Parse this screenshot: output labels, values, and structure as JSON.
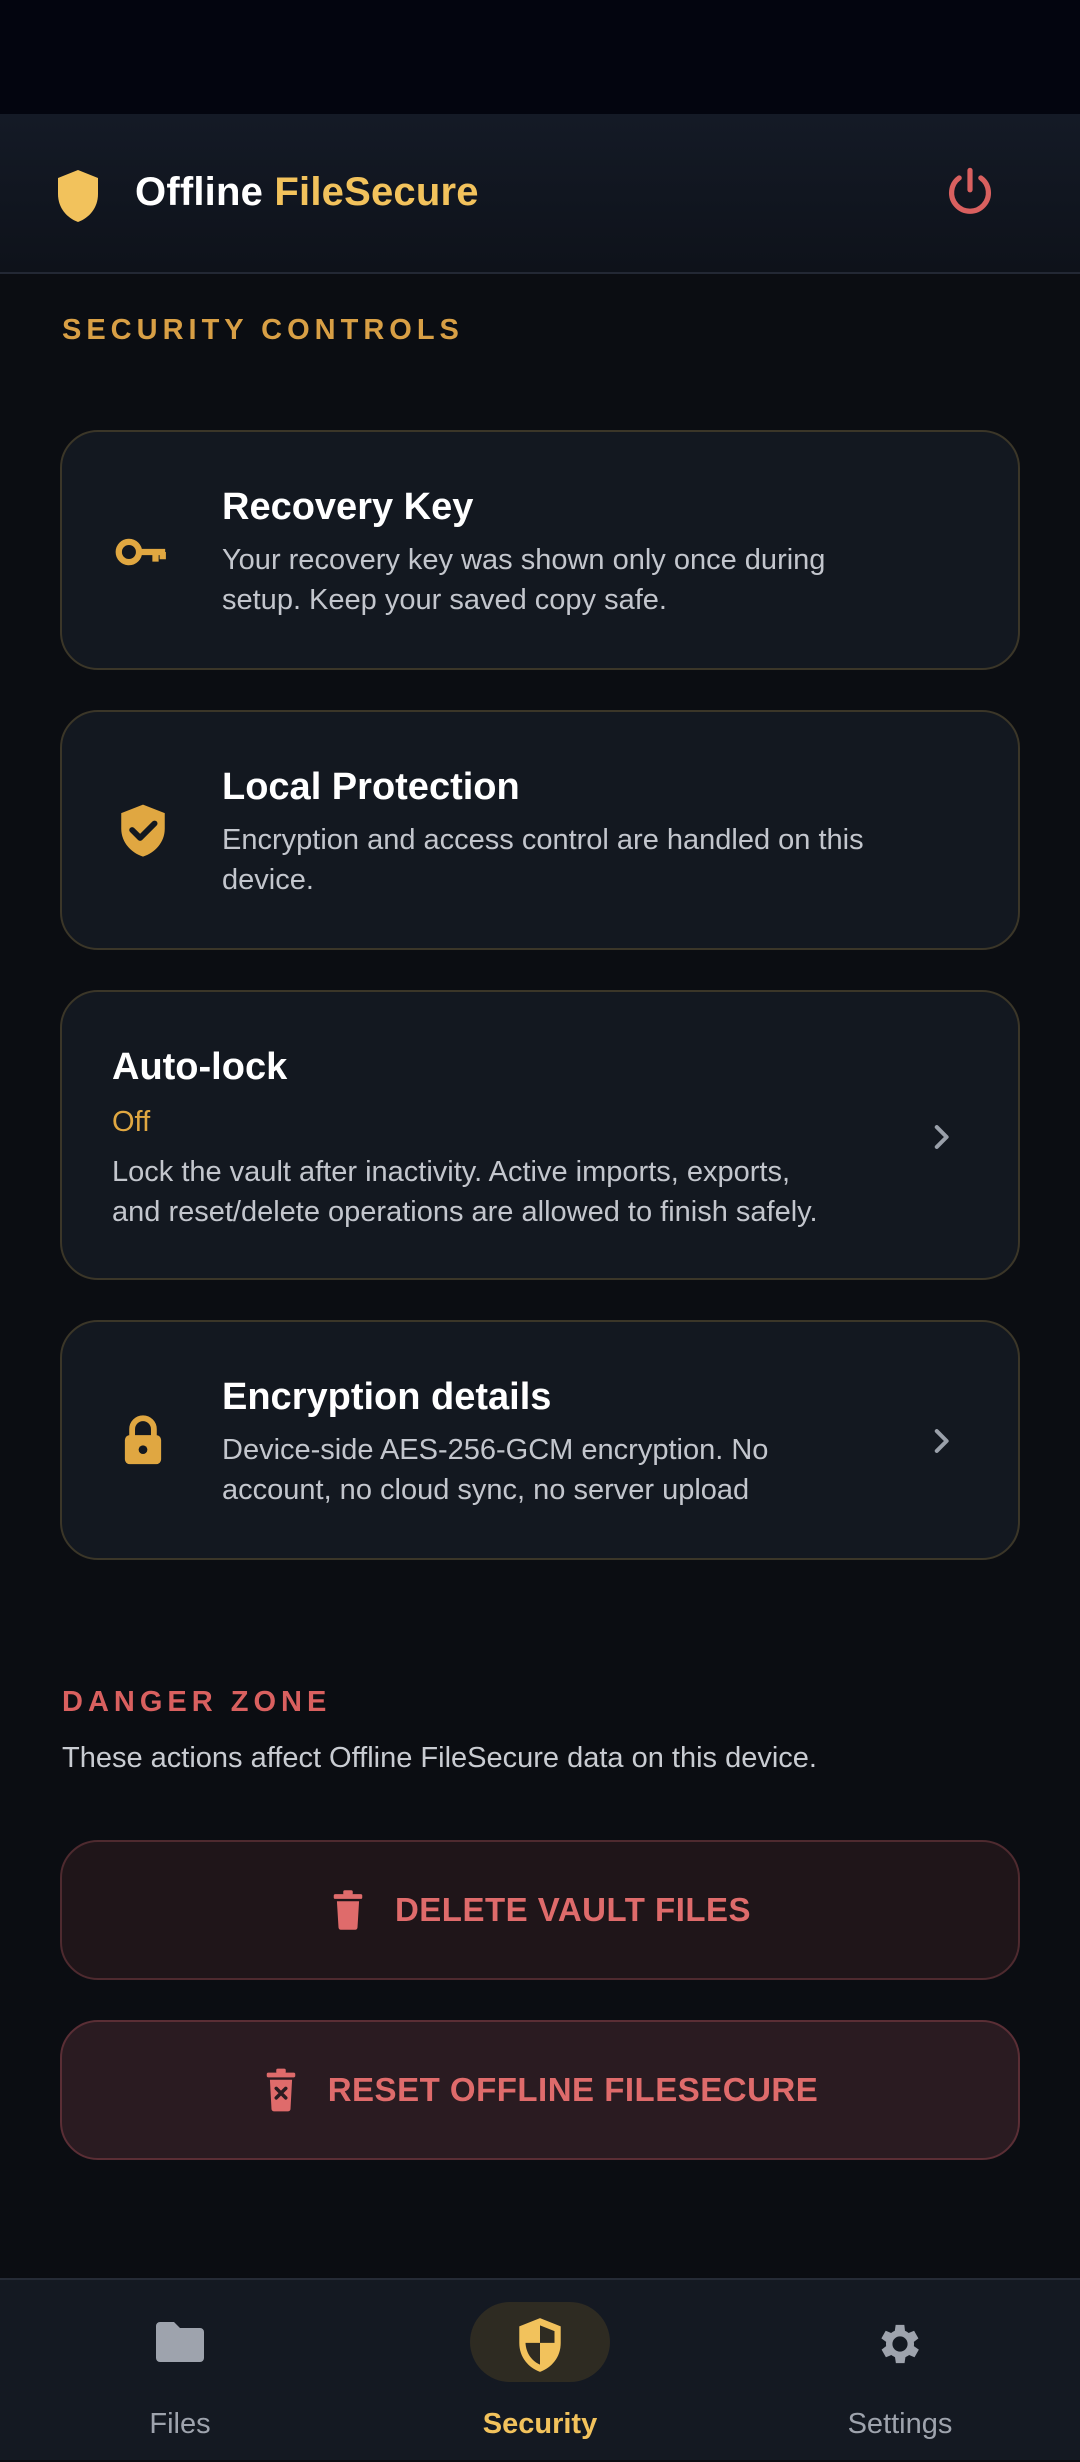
{
  "app": {
    "title_part1": "Offline",
    "title_part2": "FileSecure",
    "accent_color": "#f2c25c",
    "logo_icon": "shield-icon",
    "power_icon": "power-icon"
  },
  "sections": {
    "security_label": "SECURITY CONTROLS",
    "danger_label": "DANGER ZONE",
    "danger_description": "These actions affect Offline FileSecure data on this device."
  },
  "cards": {
    "recovery": {
      "icon": "key-icon",
      "title": "Recovery Key",
      "desc_line1": "Your recovery key was shown only once during",
      "desc_line2": "setup. Keep your saved copy safe."
    },
    "local": {
      "icon": "shield-check-icon",
      "title": "Local Protection",
      "desc_line1": "Encryption and access control are handled on this",
      "desc_line2": "device."
    },
    "autolock": {
      "title": "Auto-lock",
      "status": "Off",
      "desc_line1": "Lock the vault after inactivity. Active imports, exports,",
      "desc_line2": "and reset/delete operations are allowed to finish safely."
    },
    "encryption": {
      "icon": "lock-icon",
      "title": "Encryption details",
      "desc_line1": "Device-side AES-256-GCM encryption. No",
      "desc_line2": "account, no cloud sync, no server upload"
    }
  },
  "danger_buttons": {
    "delete_label": "DELETE VAULT FILES",
    "reset_label": "RESET OFFLINE FILESECURE",
    "danger_color": "#df6b6b"
  },
  "nav": {
    "files": "Files",
    "security": "Security",
    "settings": "Settings"
  }
}
